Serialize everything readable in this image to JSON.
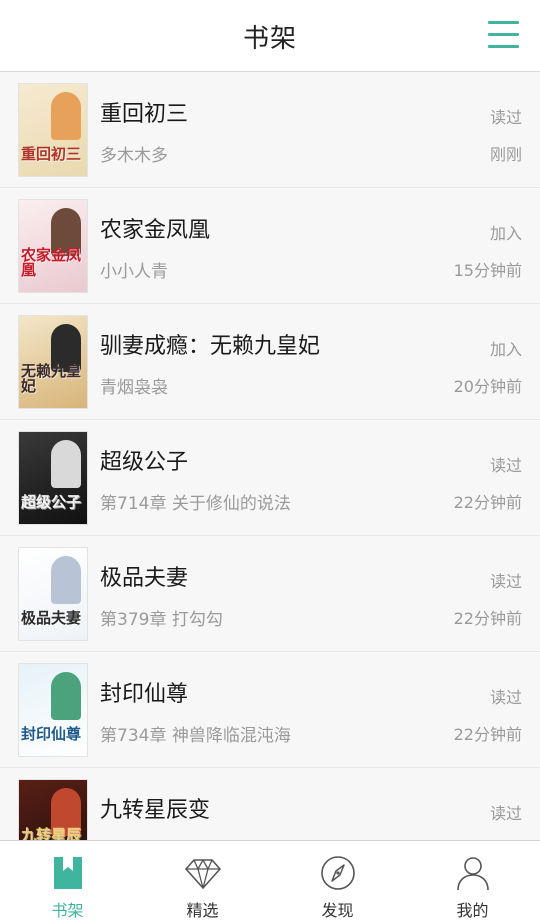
{
  "header": {
    "title": "书架"
  },
  "books": [
    {
      "title": "重回初三",
      "subtitle": "多木木多",
      "action": "读过",
      "time": "刚刚",
      "cover": {
        "bg1": "#f6ead0",
        "bg2": "#e9d9b0",
        "text": "重回初三",
        "textColor": "#b0342a",
        "fig": "#e6a25a"
      }
    },
    {
      "title": "农家金凤凰",
      "subtitle": "小小人青",
      "action": "加入",
      "time": "15分钟前",
      "cover": {
        "bg1": "#fbeef0",
        "bg2": "#e9c9cf",
        "text": "农家金凤凰",
        "textColor": "#c41c2a",
        "fig": "#6d4a3a"
      }
    },
    {
      "title": "驯妻成瘾：无赖九皇妃",
      "subtitle": "青烟袅袅",
      "action": "加入",
      "time": "20分钟前",
      "cover": {
        "bg1": "#f3e6c8",
        "bg2": "#d8b47a",
        "text": "无赖九皇妃",
        "textColor": "#3a2a2a",
        "fig": "#2b2b2b"
      }
    },
    {
      "title": "超级公子",
      "subtitle": "第714章 关于修仙的说法",
      "action": "读过",
      "time": "22分钟前",
      "cover": {
        "bg1": "#3a3a3a",
        "bg2": "#111111",
        "text": "超级公子",
        "textColor": "#f2f2f2",
        "fig": "#d9d9d9"
      }
    },
    {
      "title": "极品夫妻",
      "subtitle": "第379章 打勾勾",
      "action": "读过",
      "time": "22分钟前",
      "cover": {
        "bg1": "#ffffff",
        "bg2": "#eef2f7",
        "text": "极品夫妻",
        "textColor": "#2a2a2a",
        "fig": "#b8c3d6"
      }
    },
    {
      "title": "封印仙尊",
      "subtitle": "第734章 神兽降临混沌海",
      "action": "读过",
      "time": "22分钟前",
      "cover": {
        "bg1": "#e6f2f7",
        "bg2": "#ffffff",
        "text": "封印仙尊",
        "textColor": "#1f5a8a",
        "fig": "#4aa37a"
      }
    },
    {
      "title": "九转星辰变",
      "subtitle": "",
      "action": "读过",
      "time": "",
      "cover": {
        "bg1": "#5a1f16",
        "bg2": "#1e0f0a",
        "text": "九转星辰变",
        "textColor": "#f0d070",
        "fig": "#c0482e"
      }
    }
  ],
  "tabs": [
    {
      "label": "书架",
      "icon": "bookmark-book-icon",
      "active": true
    },
    {
      "label": "精选",
      "icon": "diamond-icon",
      "active": false
    },
    {
      "label": "发现",
      "icon": "compass-icon",
      "active": false
    },
    {
      "label": "我的",
      "icon": "user-icon",
      "active": false
    }
  ],
  "colors": {
    "accent": "#3fb5a0",
    "text": "#1a1a1a",
    "muted": "#9a9a9a"
  }
}
